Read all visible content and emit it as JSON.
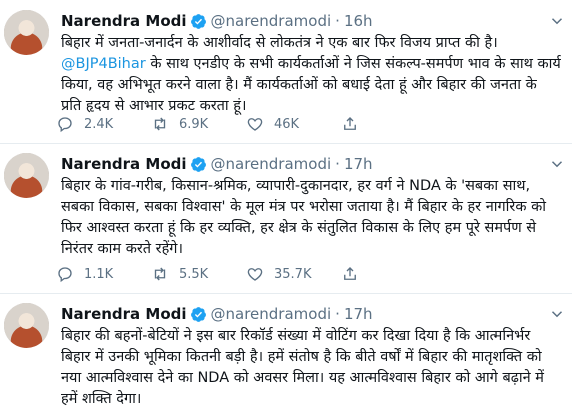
{
  "colors": {
    "accent": "#1da1f2",
    "muted": "#5b7083",
    "text": "#0f1419",
    "divider": "#e6ecf0"
  },
  "icons": [
    "verified-icon",
    "caret-down-icon",
    "reply-icon",
    "retweet-icon",
    "like-icon",
    "share-icon"
  ],
  "tweets": [
    {
      "name": "Narendra Modi",
      "handle": "@narendramodi",
      "sep": "·",
      "time": "16h",
      "text_a": "बिहार में जनता-जनार्दन के आशीर्वाद से लोकतंत्र ने एक बार फिर विजय प्राप्त की है।",
      "mention": "@BJP4Bihar",
      "text_b": " के साथ एनडीए के सभी कार्यकर्ताओं ने जिस संकल्प-समर्पण भाव के साथ कार्य किया, वह अभिभूत करने वाला है। मैं कार्यकर्ताओं को बधाई देता हूं और बिहार की जनता के प्रति हृदय से आभार प्रकट करता हूं।",
      "replies": "2.4K",
      "retweets": "6.9K",
      "likes": "46K"
    },
    {
      "name": "Narendra Modi",
      "handle": "@narendramodi",
      "sep": "·",
      "time": "17h",
      "text": "बिहार के गांव-गरीब, किसान-श्रमिक, व्यापारी-दुकानदार, हर वर्ग ने NDA के 'सबका साथ, सबका विकास, सबका विश्वास' के मूल मंत्र पर भरोसा जताया है। मैं बिहार के हर नागरिक को फिर आश्वस्त करता हूं कि हर व्यक्ति, हर क्षेत्र के संतुलित विकास के लिए हम पूरे समर्पण से निरंतर काम करते रहेंगे।",
      "replies": "1.1K",
      "retweets": "5.5K",
      "likes": "35.7K"
    },
    {
      "name": "Narendra Modi",
      "handle": "@narendramodi",
      "sep": "·",
      "time": "17h",
      "text": "बिहार की बहनों-बेटियों ने इस बार रिकॉर्ड संख्या में वोटिंग कर दिखा दिया है कि आत्मनिर्भर बिहार में उनकी भूमिका कितनी बड़ी है। हमें संतोष है कि बीते वर्षों में बिहार की मातृशक्ति को नया आत्मविश्वास देने का NDA को अवसर मिला। यह आत्मविश्वास बिहार को आगे बढ़ाने में हमें शक्ति देगा।"
    }
  ]
}
